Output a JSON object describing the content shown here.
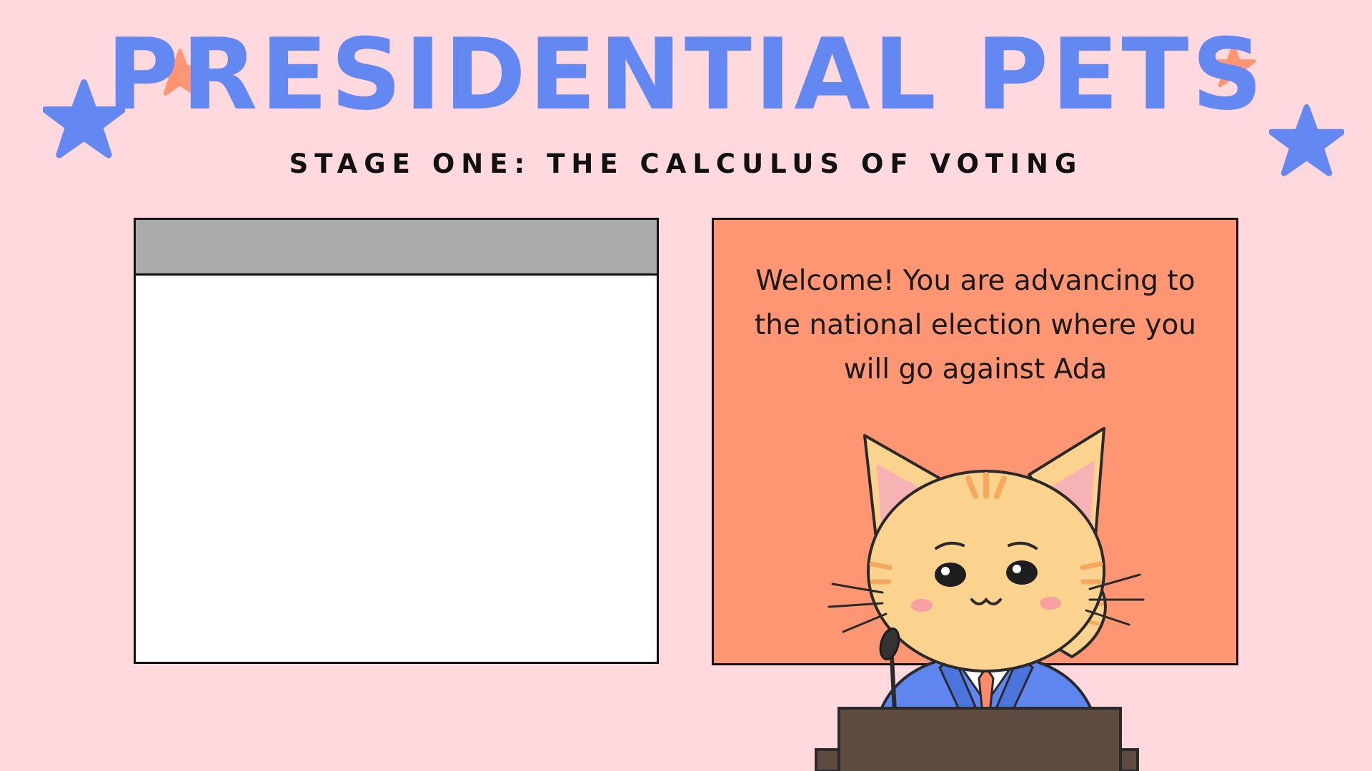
{
  "header": {
    "title": "PRESIDENTIAL PETS",
    "subtitle": "STAGE ONE: THE CALCULUS OF VOTING"
  },
  "dialog": {
    "message": "Welcome! You are advancing to the national election where you will go against Ada"
  },
  "colors": {
    "background": "#ffd9de",
    "title_blue": "#6388f2",
    "dialog_orange": "#ff9673",
    "star_orange": "#ff9673",
    "window_titlebar_gray": "#ababab"
  },
  "icons": [
    "star-icon",
    "cat-candidate-illustration",
    "podium",
    "microphone-icon"
  ]
}
